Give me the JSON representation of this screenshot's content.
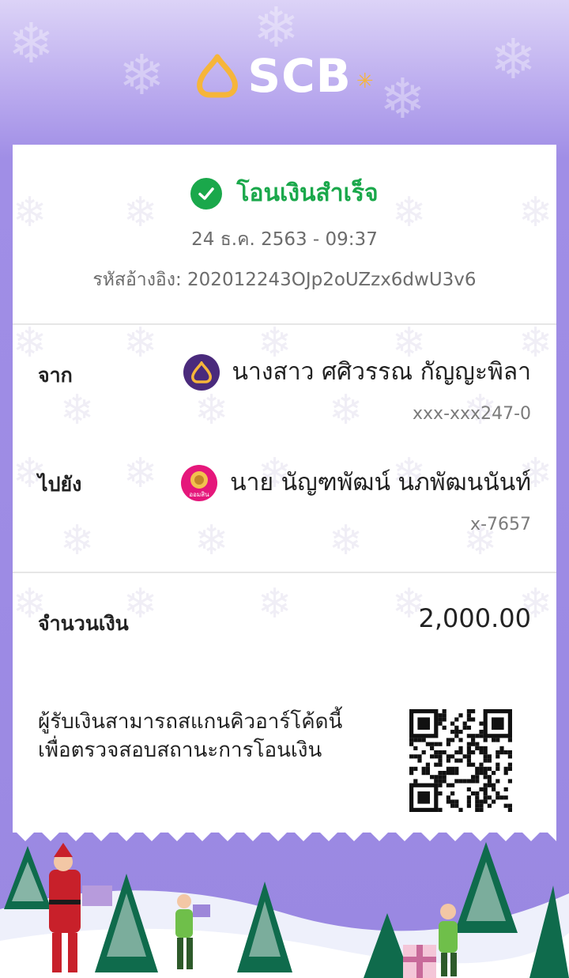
{
  "brand": {
    "logo_text": "SCB",
    "accent": "#4a2a7c",
    "gold": "#f6b53a"
  },
  "status": {
    "text": "โอนเงินสำเร็จ",
    "color": "#1aa84b"
  },
  "transaction": {
    "datetime": "24 ธ.ค. 2563 - 09:37",
    "reference": "รหัสอ้างอิง: 202012243OJp2oUZzx6dwU3v6"
  },
  "from": {
    "label": "จาก",
    "name": "นางสาว ศศิวรรณ กัญญะพิลา",
    "account": "xxx-xxx247-0",
    "bank_icon": "scb-bank-icon"
  },
  "to": {
    "label": "ไปยัง",
    "name": "นาย นัญฑพัฒน์ นภพัฒนนันท์",
    "account": "x-7657",
    "bank_icon": "gsb-bank-icon",
    "bank_icon_caption": "ออมสิน"
  },
  "amount": {
    "label": "จำนวนเงิน",
    "value": "2,000.00"
  },
  "qr": {
    "note_line1": "ผู้รับเงินสามารถสแกนคิวอาร์โค้ดนี้",
    "note_line2": "เพื่อตรวจสอบสถานะการโอนเงิน"
  }
}
